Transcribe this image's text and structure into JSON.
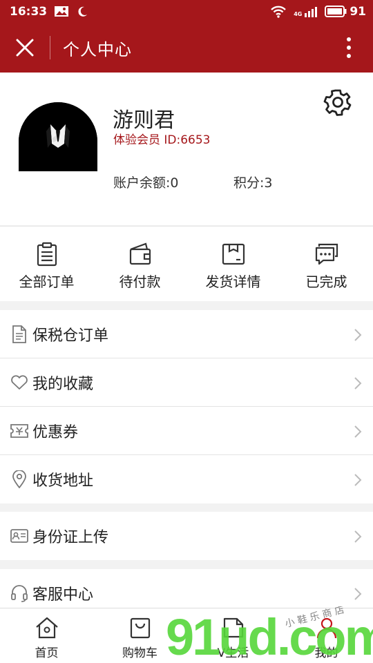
{
  "status_bar": {
    "time": "16:33",
    "network": "4G",
    "battery": "91"
  },
  "header": {
    "title": "个人中心"
  },
  "profile": {
    "name": "游则君",
    "member_line": "体验会员 ID:6653",
    "balance": "账户余额:0",
    "points": "积分:3"
  },
  "orders": [
    {
      "label": "全部订单",
      "icon": "clipboard-icon"
    },
    {
      "label": "待付款",
      "icon": "wallet-icon"
    },
    {
      "label": "发货详情",
      "icon": "package-icon"
    },
    {
      "label": "已完成",
      "icon": "chat-icon"
    }
  ],
  "menu": {
    "group1": [
      {
        "label": "保税仓订单",
        "icon": "document-icon"
      },
      {
        "label": "我的收藏",
        "icon": "heart-icon"
      },
      {
        "label": "优惠券",
        "icon": "coupon-icon"
      },
      {
        "label": "收货地址",
        "icon": "location-icon"
      }
    ],
    "group2": [
      {
        "label": "身份证上传",
        "icon": "id-card-icon"
      }
    ],
    "group3": [
      {
        "label": "客服中心",
        "icon": "headset-icon"
      }
    ]
  },
  "tabs": [
    {
      "label": "首页",
      "icon": "home-icon"
    },
    {
      "label": "购物车",
      "icon": "cart-icon"
    },
    {
      "label": "V生活",
      "icon": "tag-icon"
    },
    {
      "label": "我的",
      "icon": "user-icon"
    }
  ],
  "watermark": {
    "text": "91ud.com",
    "small": "小 鞋 乐 商 店"
  },
  "colors": {
    "brand": "#a5171b",
    "background": "#f2f2f2",
    "watermark": "#56d63a"
  }
}
